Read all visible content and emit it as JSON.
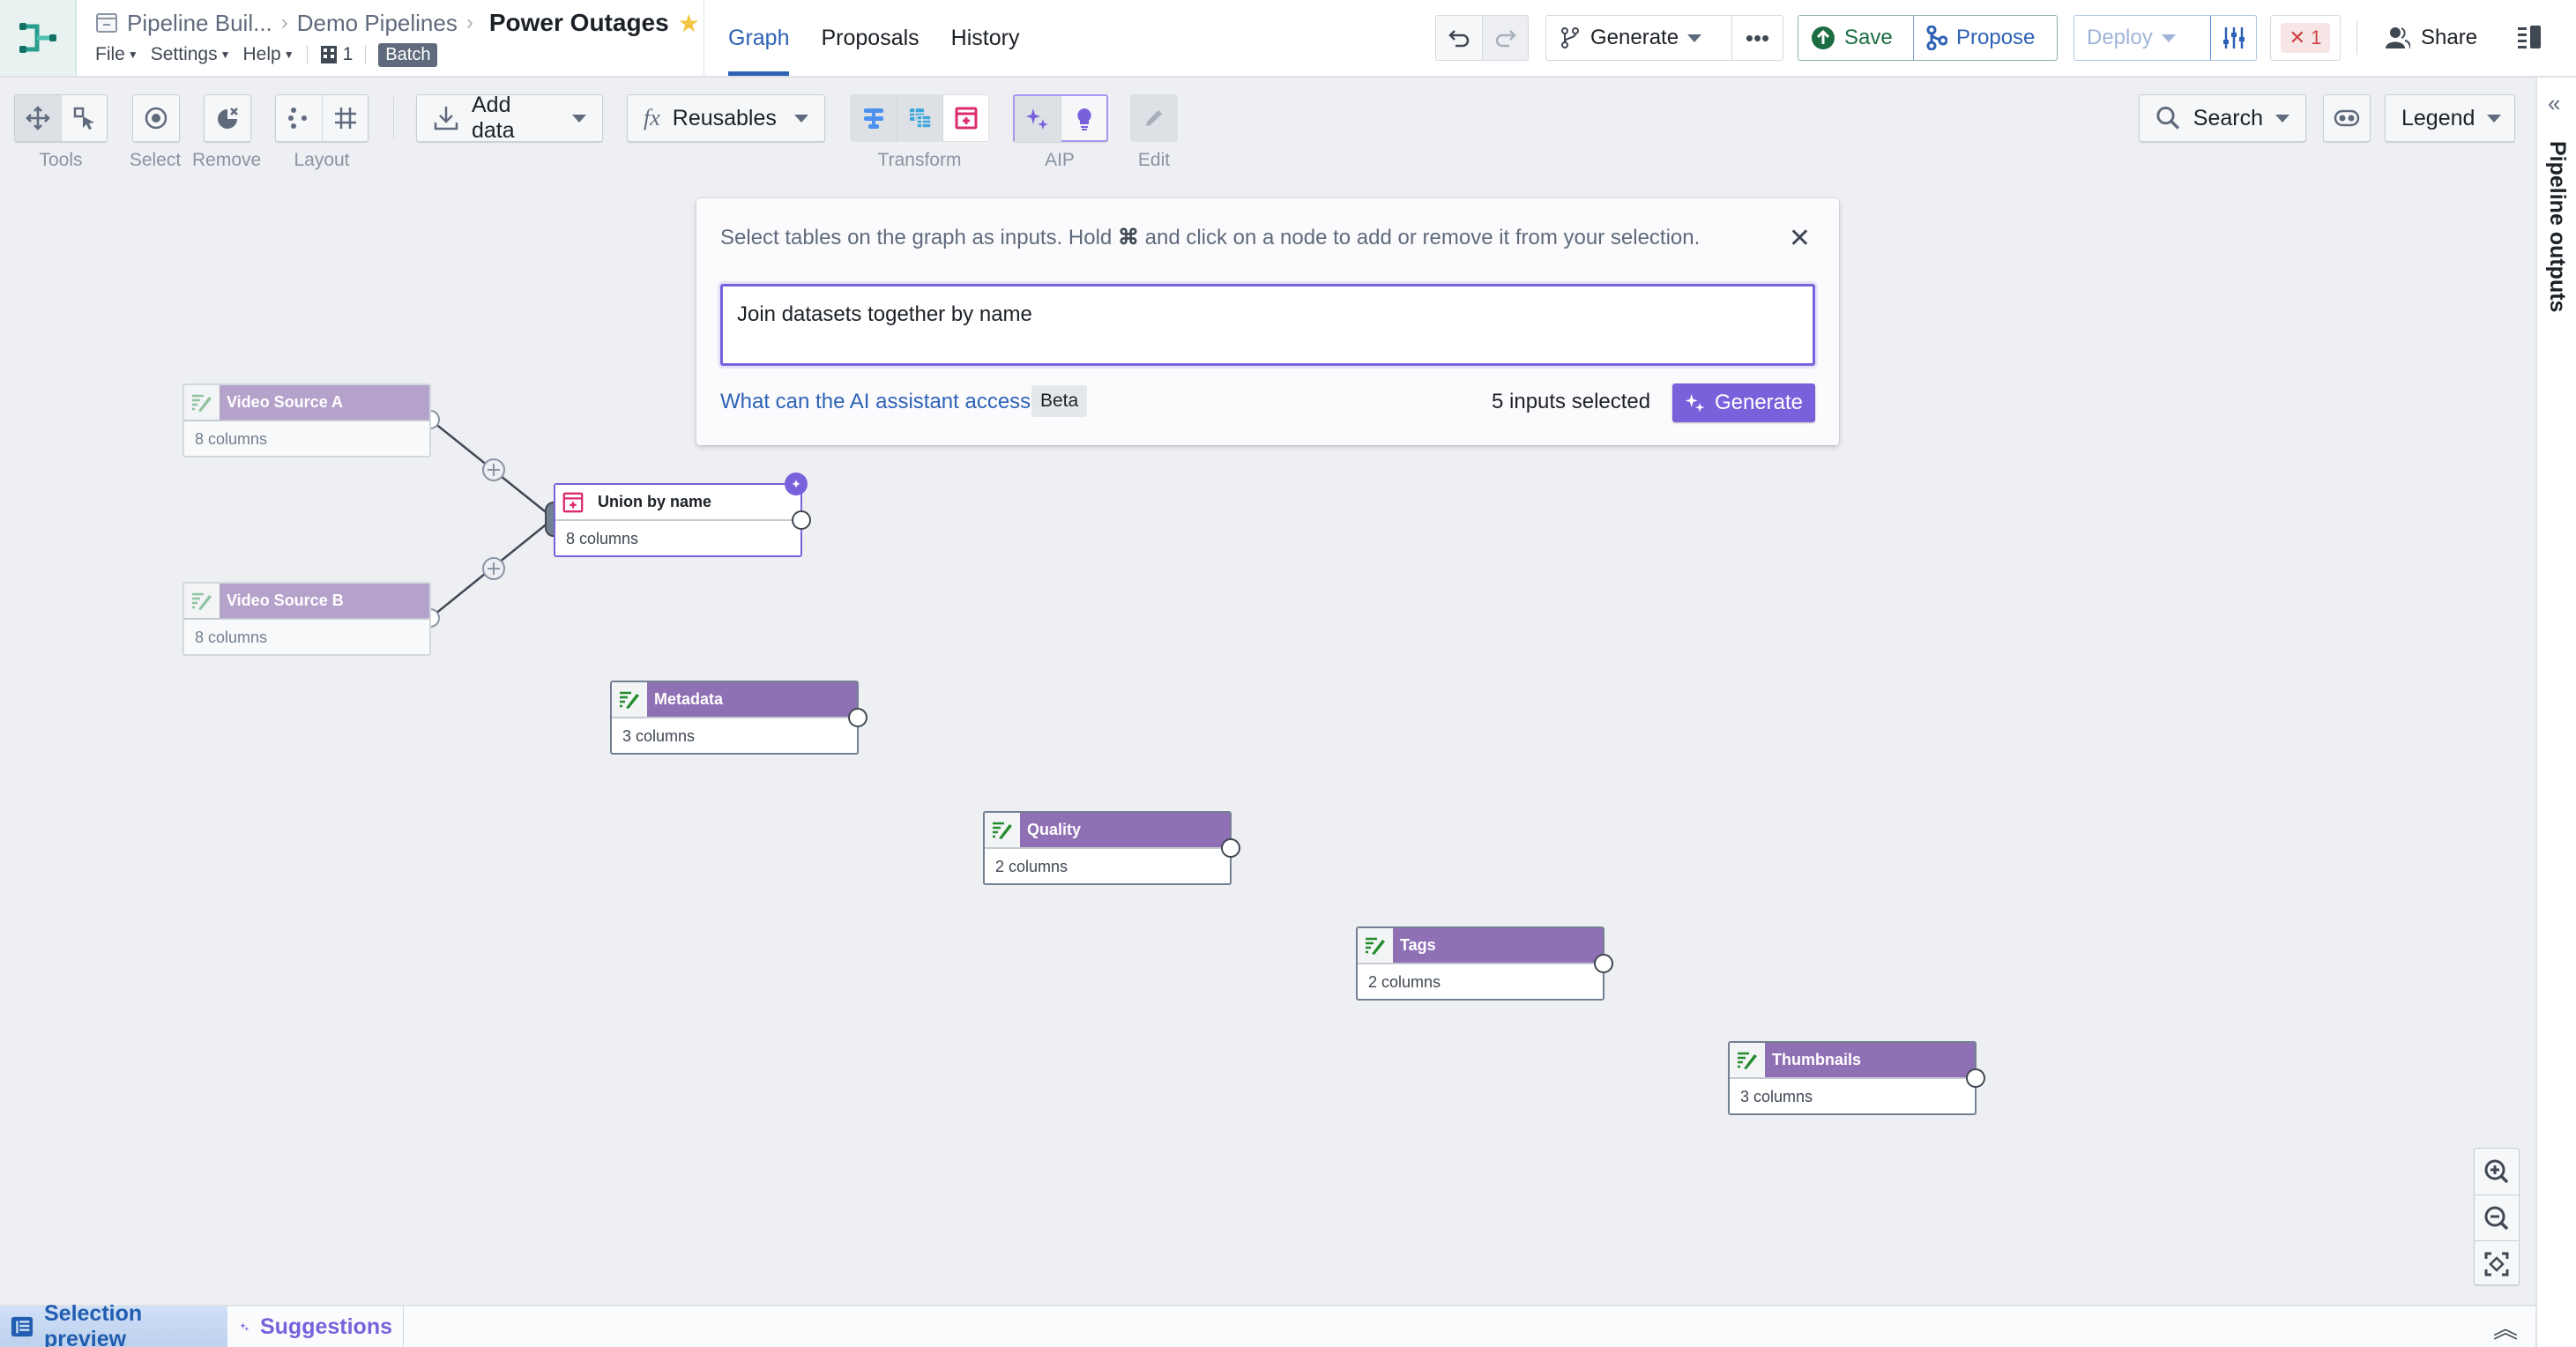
{
  "header": {
    "app_icon": "pipeline-builder-logo",
    "breadcrumbs": [
      "Pipeline Buil...",
      "Demo Pipelines"
    ],
    "title": "Power Outages",
    "favorite": true,
    "menus": [
      "File",
      "Settings",
      "Help"
    ],
    "branch_count": "1",
    "mode_badge": "Batch",
    "tabs": [
      {
        "label": "Graph",
        "active": true
      },
      {
        "label": "Proposals",
        "active": false
      },
      {
        "label": "History",
        "active": false
      }
    ],
    "actions": {
      "generate": "Generate",
      "save": "Save",
      "propose": "Propose",
      "deploy": "Deploy",
      "error_count": "1",
      "share": "Share"
    }
  },
  "toolbar": {
    "groups": [
      {
        "label": "Tools"
      },
      {
        "label": "Select"
      },
      {
        "label": "Remove"
      },
      {
        "label": "Layout"
      },
      {
        "label": "Transform"
      },
      {
        "label": "AIP"
      },
      {
        "label": "Edit"
      }
    ],
    "add_data": "Add data",
    "reusables": "Reusables",
    "reusables_icon_text": "fx",
    "search": "Search",
    "legend": "Legend"
  },
  "right_panel": {
    "label": "Pipeline outputs"
  },
  "ai_dialog": {
    "hint_before": "Select tables on the graph as inputs. Hold",
    "hint_key": "⌘",
    "hint_after": "and click on a node to add or remove it from your selection.",
    "prompt_value": "Join datasets together by name",
    "access_link": "What can the AI assistant access?",
    "beta_badge": "Beta",
    "inputs_selected": "5 inputs selected",
    "generate_button": "Generate"
  },
  "graph": {
    "nodes": [
      {
        "id": "video-source-a",
        "title": "Video Source A",
        "subtitle": "8 columns",
        "state": "faded"
      },
      {
        "id": "video-source-b",
        "title": "Video Source B",
        "subtitle": "8 columns",
        "state": "faded"
      },
      {
        "id": "union-by-name",
        "title": "Union by name",
        "subtitle": "8 columns",
        "state": "ai-suggested"
      },
      {
        "id": "metadata",
        "title": "Metadata",
        "subtitle": "3 columns",
        "state": "selected"
      },
      {
        "id": "quality",
        "title": "Quality",
        "subtitle": "2 columns",
        "state": "selected"
      },
      {
        "id": "tags",
        "title": "Tags",
        "subtitle": "2 columns",
        "state": "selected"
      },
      {
        "id": "thumbnails",
        "title": "Thumbnails",
        "subtitle": "3 columns",
        "state": "selected"
      }
    ],
    "edges": [
      {
        "from": "video-source-a",
        "to": "union-by-name"
      },
      {
        "from": "video-source-b",
        "to": "union-by-name"
      }
    ]
  },
  "bottom_bar": {
    "selection_preview": "Selection preview",
    "suggestions": "Suggestions"
  },
  "colors": {
    "accent_blue": "#2d62b6",
    "aip_purple": "#7961db",
    "node_header": "#8f70b4",
    "save_green": "#1c6e42",
    "error_red": "#cd4246"
  }
}
